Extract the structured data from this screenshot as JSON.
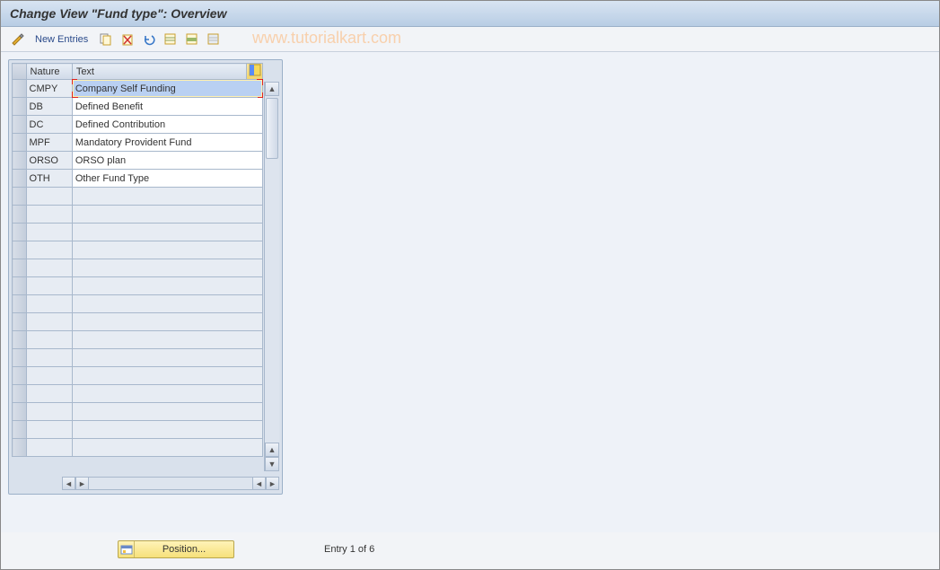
{
  "title": "Change View \"Fund type\": Overview",
  "toolbar": {
    "new_entries_label": "New Entries",
    "icons": {
      "toggle": "toggle-display-change-icon",
      "copy": "copy-icon",
      "delete": "delete-icon",
      "undo": "undo-icon",
      "select_all": "select-all-icon",
      "select_block": "select-block-icon",
      "deselect_all": "deselect-all-icon"
    }
  },
  "watermark": "www.tutorialkart.com",
  "table": {
    "columns": {
      "nature": "Nature",
      "text": "Text"
    },
    "rows": [
      {
        "nature": "CMPY",
        "text": "Company Self Funding"
      },
      {
        "nature": "DB",
        "text": "Defined Benefit"
      },
      {
        "nature": "DC",
        "text": "Defined Contribution"
      },
      {
        "nature": "MPF",
        "text": "Mandatory Provident Fund"
      },
      {
        "nature": "ORSO",
        "text": "ORSO plan"
      },
      {
        "nature": "OTH",
        "text": "Other Fund Type"
      }
    ],
    "empty_row_count": 15,
    "selected_cell": {
      "row": 0,
      "col": "text"
    }
  },
  "footer": {
    "position_label": "Position...",
    "entry_status": "Entry 1 of 6"
  }
}
